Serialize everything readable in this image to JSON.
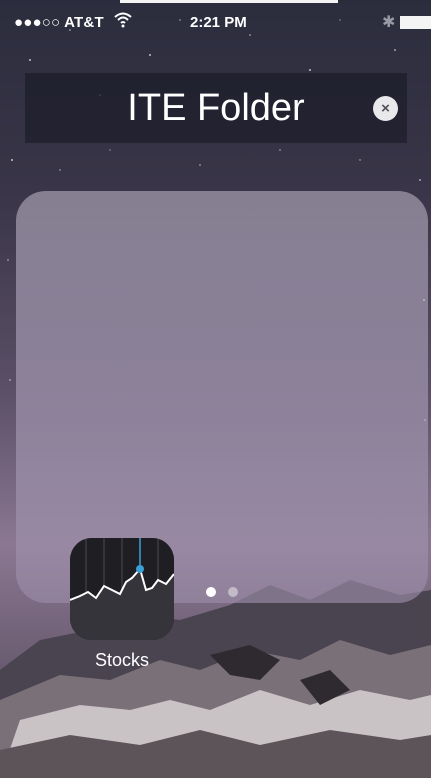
{
  "status_bar": {
    "signal": "●●●○○",
    "carrier": "AT&T",
    "time": "2:21 PM",
    "bluetooth": "✱"
  },
  "folder": {
    "title": "ITE Folder",
    "close": "×",
    "apps": [
      {
        "label": "Stocks",
        "icon": "stocks-icon"
      }
    ],
    "page_count": 2,
    "current_page": 1
  },
  "colors": {
    "panel": "#b8acc4",
    "accent_line": "#3aa0d8"
  }
}
